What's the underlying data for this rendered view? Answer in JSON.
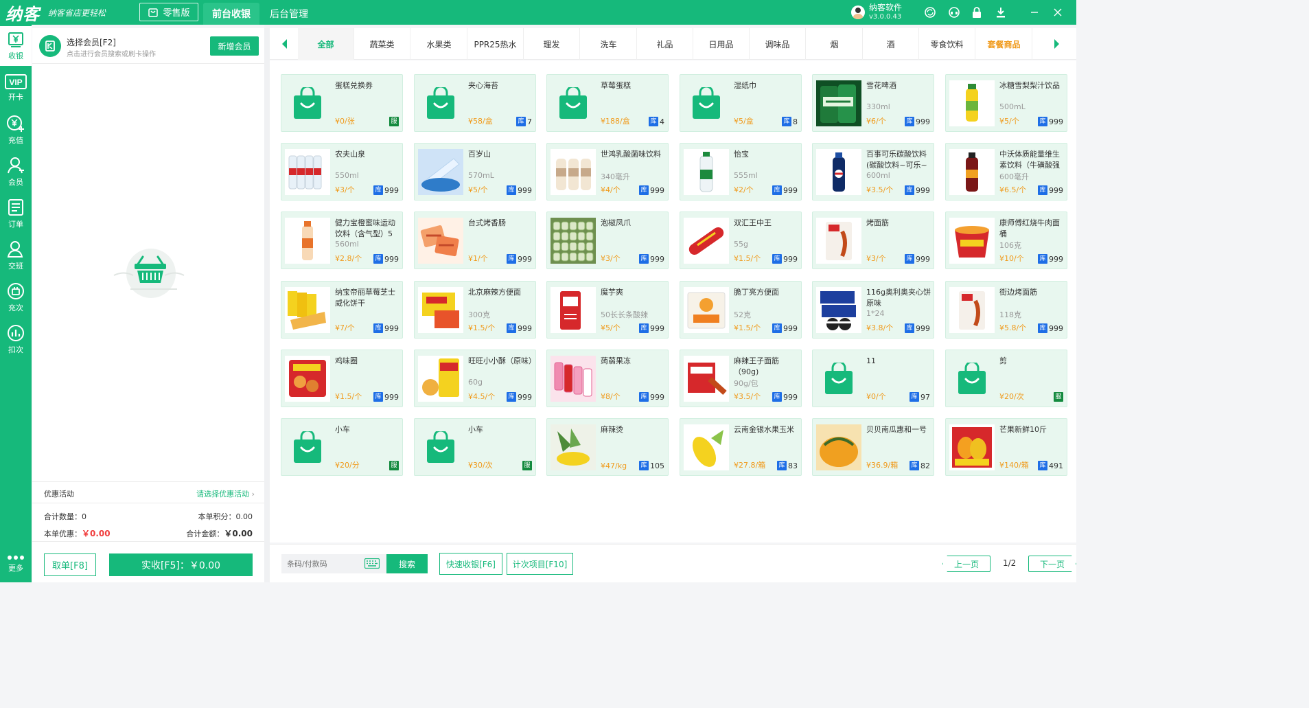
{
  "app": {
    "logo_text": "纳客",
    "slogan": "纳客省店更轻松",
    "edition": "零售版",
    "tabs": [
      "前台收银",
      "后台管理"
    ],
    "user_name": "纳客软件",
    "version": "v3.0.0.43",
    "brand_color": "#16b97b",
    "top_icons": [
      "refresh-icon",
      "headset-icon",
      "lock-icon",
      "download-icon",
      "minimize-icon",
      "close-icon"
    ]
  },
  "nav": [
    {
      "label": "收银",
      "icon": "yen-icon"
    },
    {
      "label": "开卡",
      "icon": "vip-icon"
    },
    {
      "label": "充值",
      "icon": "recharge-icon"
    },
    {
      "label": "会员",
      "icon": "member-icon"
    },
    {
      "label": "订单",
      "icon": "order-icon"
    },
    {
      "label": "交班",
      "icon": "handover-icon"
    },
    {
      "label": "充次",
      "icon": "times-recharge-icon"
    },
    {
      "label": "扣次",
      "icon": "times-deduct-icon"
    },
    {
      "label": "更多",
      "icon": "more-icon"
    }
  ],
  "member": {
    "title": "选择会员[F2]",
    "subtitle": "点击进行会员搜索或刷卡操作",
    "new_button": "新增会员"
  },
  "summary": {
    "promo_label": "优惠活动",
    "promo_select": "请选择优惠活动",
    "qty_label": "合计数量：",
    "qty_value": "0",
    "points_label": "本单积分：",
    "points_value": "0.00",
    "discount_label": "本单优惠：",
    "discount_value": "￥0.00",
    "total_label": "合计金额：",
    "total_value": "￥0.00",
    "cancel_button": "取单[F8]",
    "pay_button": "实收[F5]：￥0.00"
  },
  "categories": [
    "全部",
    "蔬菜类",
    "水果类",
    "PPR25热水",
    "理发",
    "洗车",
    "礼品",
    "日用品",
    "调味品",
    "烟",
    "酒",
    "零食饮料",
    "套餐商品"
  ],
  "products": [
    {
      "name": "蛋糕兑换券",
      "spec": "",
      "price": "¥0/张",
      "stock": "",
      "service": true,
      "img": "bag"
    },
    {
      "name": "夹心海苔",
      "spec": "",
      "price": "¥58/盒",
      "stock": "7",
      "img": "bag"
    },
    {
      "name": "草莓蛋糕",
      "spec": "",
      "price": "¥188/盒",
      "stock": "4",
      "img": "bag"
    },
    {
      "name": "湿纸巾",
      "spec": "",
      "price": "¥5/盒",
      "stock": "8",
      "img": "bag"
    },
    {
      "name": "雪花啤酒",
      "spec": "330ml",
      "price": "¥6/个",
      "stock": "999",
      "img": "beer"
    },
    {
      "name": "冰糖雪梨梨汁饮品",
      "spec": "500mL",
      "price": "¥5/个",
      "stock": "999",
      "img": "juice"
    },
    {
      "name": "农夫山泉",
      "spec": "550ml",
      "price": "¥3/个",
      "stock": "999",
      "img": "water-pack"
    },
    {
      "name": "百岁山",
      "spec": "570mL",
      "price": "¥5/个",
      "stock": "999",
      "img": "water-blue"
    },
    {
      "name": "世鸿乳酸菌味饮料",
      "spec": "340毫升",
      "price": "¥4/个",
      "stock": "999",
      "img": "milk"
    },
    {
      "name": "怡宝",
      "spec": "555ml",
      "price": "¥2/个",
      "stock": "999",
      "img": "water-green"
    },
    {
      "name": "百事可乐碳酸饮料(碳酸饮料~可乐~",
      "spec": "600ml",
      "price": "¥3.5/个",
      "stock": "999",
      "img": "cola"
    },
    {
      "name": "中沃体质能量维生素饮料（牛磺酸强",
      "spec": "600毫升",
      "price": "¥6.5/个",
      "stock": "999",
      "img": "energy"
    },
    {
      "name": "健力宝橙蜜味运动饮料（含气型）5",
      "spec": "560ml",
      "price": "¥2.8/个",
      "stock": "999",
      "img": "orange-drink"
    },
    {
      "name": "台式烤香肠",
      "spec": "",
      "price": "¥1/个",
      "stock": "999",
      "img": "sausage-pack"
    },
    {
      "name": "泡椒凤爪",
      "spec": "",
      "price": "¥3/个",
      "stock": "999",
      "img": "chicken-feet"
    },
    {
      "name": "双汇王中王",
      "spec": "55g",
      "price": "¥1.5/个",
      "stock": "999",
      "img": "ham"
    },
    {
      "name": "烤面筋",
      "spec": "",
      "price": "¥3/个",
      "stock": "999",
      "img": "gluten"
    },
    {
      "name": "康师傅红烧牛肉面桶",
      "spec": "106克",
      "price": "¥10/个",
      "stock": "999",
      "img": "noodle-bowl"
    },
    {
      "name": "纳宝帝丽草莓芝士威化饼干",
      "spec": "",
      "price": "¥7/个",
      "stock": "999",
      "img": "wafer"
    },
    {
      "name": "北京麻辣方便面",
      "spec": "300克",
      "price": "¥1.5/个",
      "stock": "999",
      "img": "spicy-noodle"
    },
    {
      "name": "魔芋爽",
      "spec": "50长长条酸辣",
      "price": "¥5/个",
      "stock": "999",
      "img": "konjac"
    },
    {
      "name": "脆丁亮方便面",
      "spec": "52克",
      "price": "¥1.5/个",
      "stock": "999",
      "img": "instant-noodle"
    },
    {
      "name": "116g奥利奥夹心饼 原味",
      "spec": "1*24",
      "price": "¥3.8/个",
      "stock": "999",
      "img": "oreo"
    },
    {
      "name": "街边烤面筋",
      "spec": "118克",
      "price": "¥5.8/个",
      "stock": "999",
      "img": "gluten"
    },
    {
      "name": "鸡味圈",
      "spec": "",
      "price": "¥1.5/个",
      "stock": "999",
      "img": "chicken-ring"
    },
    {
      "name": "旺旺小小酥（原味）",
      "spec": "60g",
      "price": "¥4.5/个",
      "stock": "999",
      "img": "wangwang"
    },
    {
      "name": "蒟蒻果冻",
      "spec": "",
      "price": "¥8/个",
      "stock": "999",
      "img": "jelly"
    },
    {
      "name": "麻辣王子面筋（90g)",
      "spec": "90g/包",
      "price": "¥3.5/个",
      "stock": "999",
      "img": "mala"
    },
    {
      "name": "11",
      "spec": "",
      "price": "¥0/个",
      "stock": "97",
      "img": "bag"
    },
    {
      "name": "剪",
      "spec": "",
      "price": "¥20/次",
      "stock": "",
      "service": true,
      "img": "bag"
    },
    {
      "name": "小车",
      "spec": "",
      "price": "¥20/分",
      "stock": "",
      "service": true,
      "img": "bag"
    },
    {
      "name": "小车",
      "spec": "",
      "price": "¥30/次",
      "stock": "",
      "service": true,
      "img": "bag"
    },
    {
      "name": "麻辣烫",
      "spec": "",
      "price": "¥47/kg",
      "stock": "105",
      "img": "malatang"
    },
    {
      "name": "云南金银水果玉米",
      "spec": "",
      "price": "¥27.8/箱",
      "stock": "83",
      "img": "corn"
    },
    {
      "name": "贝贝南瓜惠和一号",
      "spec": "",
      "price": "¥36.9/箱",
      "stock": "82",
      "img": "pumpkin"
    },
    {
      "name": "芒果新鲜10斤",
      "spec": "",
      "price": "¥140/箱",
      "stock": "491",
      "img": "mango"
    }
  ],
  "labels": {
    "stock_tag": "库",
    "service_tag": "服"
  },
  "bottom": {
    "barcode_placeholder": "条码/付款码",
    "search_button": "搜索",
    "quick_button": "快速收银[F6]",
    "times_button": "计次项目[F10]",
    "prev_button": "上一页",
    "page_indicator": "1/2",
    "next_button": "下一页"
  }
}
